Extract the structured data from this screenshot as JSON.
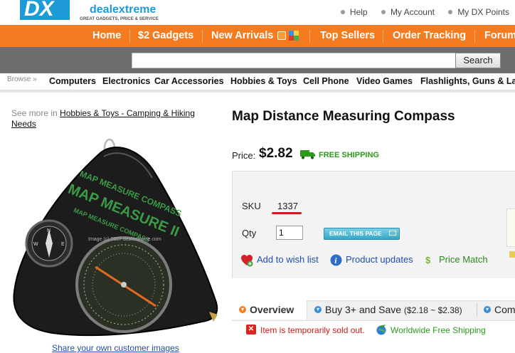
{
  "brand": {
    "logo_letters": "DX",
    "name": "dealextreme",
    "tagline": "GREAT GADGETS, PRICE & SERVICE"
  },
  "top_links": [
    {
      "label": "Help"
    },
    {
      "label": "My Account"
    },
    {
      "label": "My DX Points"
    }
  ],
  "nav": {
    "items": [
      "Home",
      "$2 Gadgets",
      "New Arrivals",
      "Top Sellers",
      "Order Tracking",
      "Forum"
    ]
  },
  "search": {
    "value": "",
    "button_label": "Search"
  },
  "categories": {
    "browse_label": "Browse »",
    "items": [
      "Computers",
      "Electronics",
      "Car Accessories",
      "Hobbies & Toys",
      "Cell Phone",
      "Video Games",
      "Flashlights, Guns & Lasers"
    ]
  },
  "breadcrumb": {
    "prefix": "See more in",
    "link": "Hobbies & Toys - Camping & Hiking Needs"
  },
  "image": {
    "watermark": "Image (c) 2007 dealextreme.com",
    "device_text_1": "MAP MEASURE COMPASS",
    "device_text_2": "MAP MEASURE II",
    "device_text_3": "MAP MEASURE COMPASS"
  },
  "share_link": "Share your own customer images",
  "product": {
    "title": "Map Distance Measuring Compass",
    "price_label": "Price:",
    "price": "$2.82",
    "shipping": "FREE SHIPPING",
    "sku_label": "SKU",
    "sku": "1337",
    "qty_label": "Qty",
    "qty_value": "1",
    "email_button": "EMAIL THIS PAGE"
  },
  "actions": {
    "wishlist": "Add to wish list",
    "updates": "Product updates",
    "price_match": "Price Match"
  },
  "tabs": {
    "overview": "Overview",
    "buy3": "Buy 3+ and Save",
    "buy3_range": "($2.18 ~ $2.38)",
    "comments": "Com"
  },
  "status": {
    "sold_out": "Item is temporarily sold out.",
    "worldwide": "Worldwide Free Shipping"
  },
  "colors": {
    "nav_orange": "#f47b20",
    "search_gray": "#6d6d6d",
    "free_shipping_green": "#2c9a1a",
    "alert_red": "#d21a1a",
    "link_blue": "#1f4fa8"
  }
}
